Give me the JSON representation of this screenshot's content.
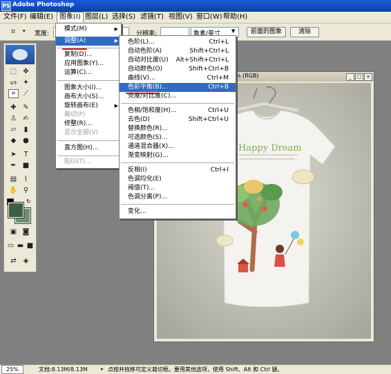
{
  "app": {
    "title": "Adobe Photoshop",
    "logo": "PS"
  },
  "menubar": [
    {
      "label": "文件(F)",
      "key": "file"
    },
    {
      "label": "编辑(E)",
      "key": "edit"
    },
    {
      "label": "图象(I)",
      "key": "image"
    },
    {
      "label": "图层(L)",
      "key": "layer"
    },
    {
      "label": "选择(S)",
      "key": "select"
    },
    {
      "label": "滤镜(T)",
      "key": "filter"
    },
    {
      "label": "视图(V)",
      "key": "view"
    },
    {
      "label": "窗口(W)",
      "key": "window"
    },
    {
      "label": "帮助(H)",
      "key": "help"
    }
  ],
  "options": {
    "width_label": "宽度:",
    "resolution_label": "分辨率:",
    "unit_value": "象素/英寸",
    "front_image_button": "前面的图象",
    "clear_button": "清除"
  },
  "image_menu": {
    "items": [
      {
        "label": "模式(M)",
        "submenu": true
      },
      {
        "label": "调整(A)",
        "submenu": true,
        "highlighted": true
      },
      {
        "label": "复制(D)..."
      },
      {
        "label": "应用图象(Y)..."
      },
      {
        "label": "运算(C)..."
      },
      {
        "label": "图象大小(I)..."
      },
      {
        "label": "画布大小(S)..."
      },
      {
        "label": "旋转画布(E)",
        "submenu": true
      },
      {
        "label": "裁切(P)",
        "disabled": true
      },
      {
        "label": "修整(R)..."
      },
      {
        "label": "显示全部(V)",
        "disabled": true
      },
      {
        "label": "直方图(H)..."
      },
      {
        "label": "陷印(T)...",
        "disabled": true
      }
    ]
  },
  "adjust_menu": {
    "items": [
      {
        "label": "色阶(L)...",
        "shortcut": "Ctrl+L"
      },
      {
        "label": "自动色阶(A)",
        "shortcut": "Shift+Ctrl+L"
      },
      {
        "label": "自动对比度(U)",
        "shortcut": "Alt+Shift+Ctrl+L"
      },
      {
        "label": "自动颜色(O)",
        "shortcut": "Shift+Ctrl+B"
      },
      {
        "label": "曲线(V)...",
        "shortcut": "Ctrl+M"
      },
      {
        "label": "色彩平衡(B)...",
        "shortcut": "Ctrl+B",
        "highlighted": true
      },
      {
        "label": "亮度/对比度(C)...",
        "shortcut": ""
      },
      {
        "label": "色相/饱和度(H)...",
        "shortcut": "Ctrl+U"
      },
      {
        "label": "去色(D)",
        "shortcut": "Shift+Ctrl+U"
      },
      {
        "label": "替换颜色(R)...",
        "shortcut": ""
      },
      {
        "label": "可选颜色(S)...",
        "shortcut": ""
      },
      {
        "label": "通道混合器(X)...",
        "shortcut": ""
      },
      {
        "label": "渐变映射(G)...",
        "shortcut": ""
      },
      {
        "label": "反相(I)",
        "shortcut": "Ctrl+I"
      },
      {
        "label": "色调均化(E)",
        "shortcut": ""
      },
      {
        "label": "阈值(T)...",
        "shortcut": ""
      },
      {
        "label": "色调分离(P)...",
        "shortcut": ""
      },
      {
        "label": "变化...",
        "shortcut": ""
      }
    ]
  },
  "document": {
    "title_visible": "% (RGB)"
  },
  "tshirt": {
    "print_text": "Happy Dream"
  },
  "status": {
    "zoom": "25%",
    "doc_size": "文档:8.13M/8.13M",
    "hint": "点按并拖移可定义裁切框。要用其他选项，使用 Shift、Alt 和 Ctrl 键。"
  },
  "colors": {
    "foreground": "#3f5f45",
    "background": "#6f8f70",
    "highlight": "#316ac5",
    "annotation": "#e01010"
  }
}
